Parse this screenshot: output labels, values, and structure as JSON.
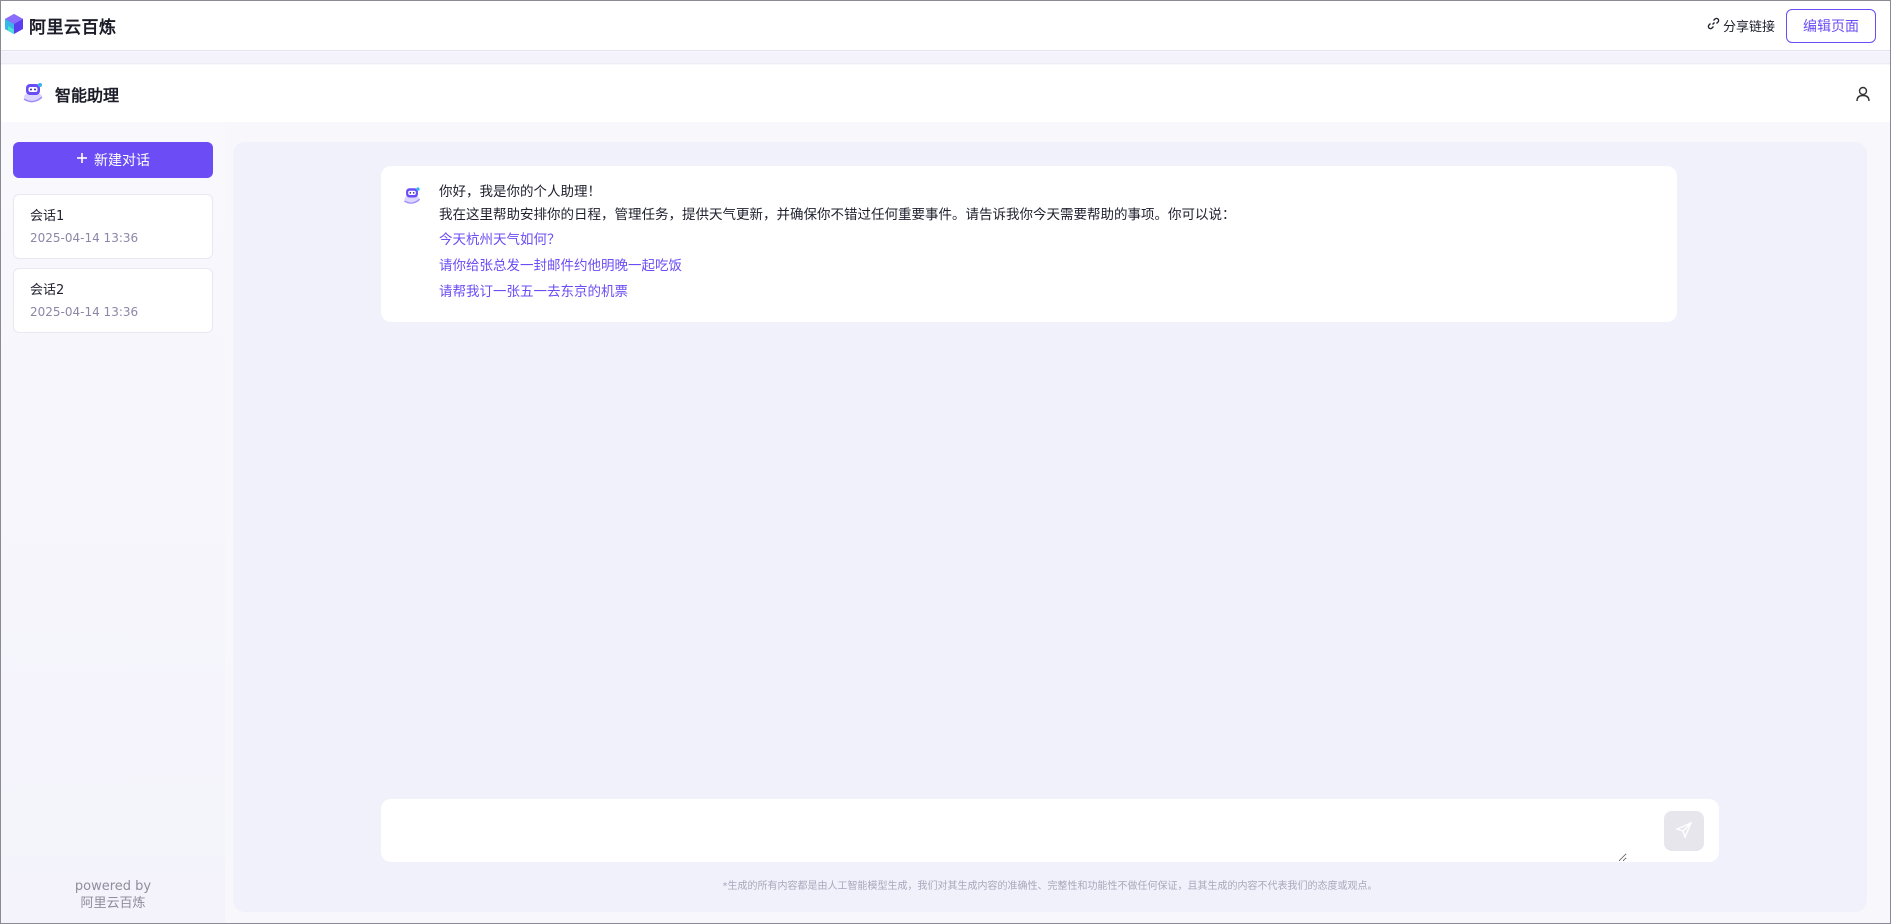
{
  "topbar": {
    "brand_name": "阿里云百炼",
    "brand_logo_icon": "layered-hexagon-logo",
    "share_link_label": "分享链接",
    "share_link_icon": "link-icon",
    "edit_button_label": "编辑页面"
  },
  "app_header": {
    "title": "智能助理",
    "avatar_icon": "robot-assistant-icon",
    "user_icon": "user-icon"
  },
  "sidebar": {
    "new_chat_label": "新建对话",
    "conversations": [
      {
        "title": "会话1",
        "time": "2025-04-14 13:36"
      },
      {
        "title": "会话2",
        "time": "2025-04-14 13:36"
      }
    ],
    "powered_by_line1": "powered by",
    "powered_by_line2": "阿里云百炼"
  },
  "chat": {
    "message": {
      "greeting": "你好，我是你的个人助理！",
      "intro": "我在这里帮助安排你的日程，管理任务，提供天气更新，并确保你不错过任何重要事件。请告诉我你今天需要帮助的事项。你可以说：",
      "suggestions": [
        "今天杭州天气如何？",
        "请你给张总发一封邮件约他明晚一起吃饭",
        "请帮我订一张五一去东京的机票"
      ]
    },
    "input_value": "",
    "send_icon": "paper-plane-icon",
    "disclaimer": "*生成的所有内容都是由人工智能模型生成，我们对其生成内容的准确性、完整性和功能性不做任何保证，且其生成的内容不代表我们的态度或观点。"
  },
  "colors": {
    "accent": "#6b4cf5",
    "background": "#f1f1fb"
  }
}
